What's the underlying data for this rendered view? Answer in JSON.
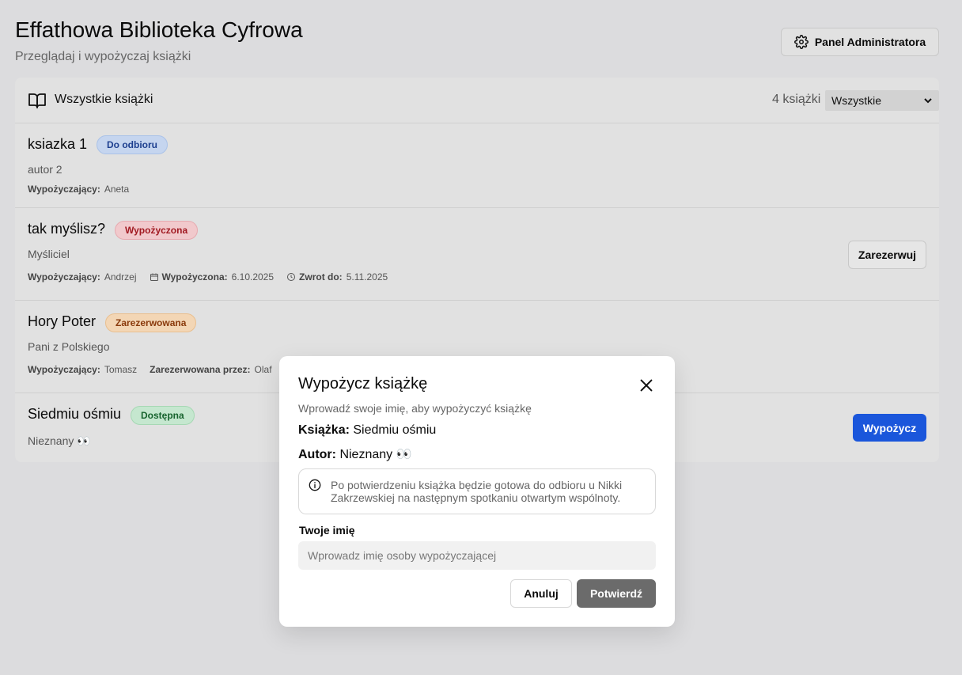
{
  "header": {
    "title": "Effathowa Biblioteka Cyfrowa",
    "subtitle": "Przeglądaj i wypożyczaj książki",
    "admin_button": "Panel Administratora"
  },
  "list": {
    "title": "Wszystkie książki",
    "count": "4 książki",
    "filter_value": "Wszystkie",
    "books": [
      {
        "title": "ksiazka 1",
        "status": "Do odbioru",
        "author": "autor 2",
        "borrower_label": "Wypożyczający:",
        "borrower": "Aneta"
      },
      {
        "title": "tak myślisz?",
        "status": "Wypożyczona",
        "author": "Myśliciel",
        "borrower_label": "Wypożyczający:",
        "borrower": "Andrzej",
        "borrowed_label": "Wypożyczona:",
        "borrowed_date": "6.10.2025",
        "due_label": "Zwrot do:",
        "due_date": "5.11.2025",
        "action": "Zarezerwuj"
      },
      {
        "title": "Hory Poter",
        "status": "Zarezerwowana",
        "author": "Pani z Polskiego",
        "borrower_label": "Wypożyczający:",
        "borrower": "Tomasz",
        "reserved_label": "Zarezerwowana przez:",
        "reserved_by": "Olaf"
      },
      {
        "title": "Siedmiu ośmiu",
        "status": "Dostępna",
        "author": "Nieznany 👀",
        "action": "Wypożycz"
      }
    ]
  },
  "modal": {
    "title": "Wypożycz książkę",
    "description": "Wprowadź swoje imię, aby wypożyczyć książkę",
    "book_label": "Książka:",
    "book_value": "Siedmiu ośmiu",
    "author_label": "Autor:",
    "author_value": "Nieznany 👀",
    "info": "Po potwierdzeniu książka będzie gotowa do odbioru u Nikki Zakrzewskiej na następnym spotkaniu otwartym wspólnoty.",
    "name_label": "Twoje imię",
    "name_placeholder": "Wprowadz imię osoby wypożyczającej",
    "name_value": "",
    "cancel": "Anuluj",
    "confirm": "Potwierdź"
  },
  "colors": {
    "primary": "#1a56db",
    "confirm_disabled": "#6b6b6b",
    "badge_pickup": "#c5d5ef",
    "badge_borrowed": "#f1c9cc",
    "badge_reserved": "#f3d6b5",
    "badge_available": "#c5e7cf"
  },
  "icons": [
    "gear-icon",
    "book-open-icon",
    "chevron-down-icon",
    "calendar-icon",
    "clock-icon",
    "close-icon",
    "info-icon"
  ]
}
